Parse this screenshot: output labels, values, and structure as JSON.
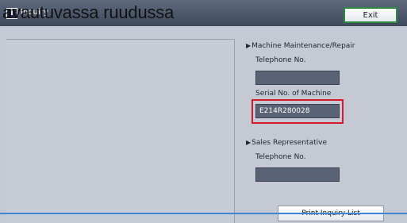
{
  "overlay": {
    "caption": "avautuvassa ruudussa"
  },
  "titlebar": {
    "title": "Inquiry",
    "icon": "info-icon",
    "exit_label": "Exit"
  },
  "maintenance": {
    "heading": "Machine Maintenance/Repair",
    "telephone_label": "Telephone No.",
    "telephone_value": "",
    "serial_label": "Serial No. of Machine",
    "serial_value": "E214R280028"
  },
  "sales": {
    "heading": "Sales Representative",
    "telephone_label": "Telephone No.",
    "telephone_value": ""
  },
  "actions": {
    "print_label": "Print Inquiry List"
  },
  "colors": {
    "highlight": "#d6182b",
    "exit_border": "#2b8a3e",
    "field_bg": "#5a6275"
  }
}
